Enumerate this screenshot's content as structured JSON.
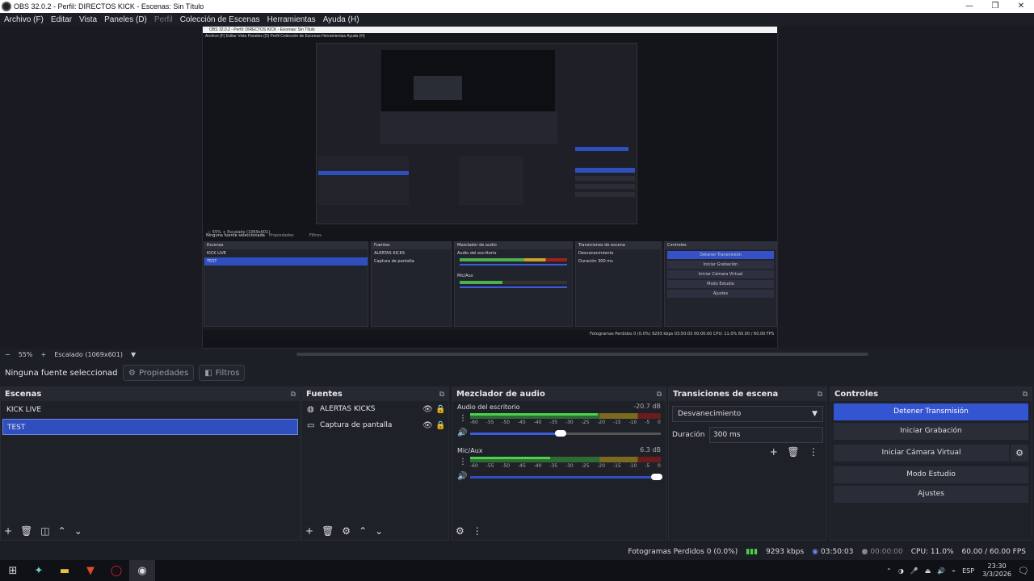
{
  "window": {
    "title": "OBS 32.0.2 - Perfil: DIRECTOS KICK - Escenas: Sin Título",
    "controls": [
      "—",
      "❐",
      "✕"
    ]
  },
  "menu": [
    {
      "label": "Archivo (F)",
      "enabled": true
    },
    {
      "label": "Editar",
      "enabled": true
    },
    {
      "label": "Vista",
      "enabled": true
    },
    {
      "label": "Paneles (D)",
      "enabled": true
    },
    {
      "label": "Perfil",
      "enabled": false
    },
    {
      "label": "Colección de Escenas",
      "enabled": true
    },
    {
      "label": "Herramientas",
      "enabled": true
    },
    {
      "label": "Ayuda (H)",
      "enabled": true
    }
  ],
  "zoom": {
    "minus": "−",
    "value": "55%",
    "plus": "+",
    "scaled": "Escalado (1069x601)"
  },
  "source_toolbar": {
    "no_source": "Ninguna fuente seleccionada",
    "properties": "Propiedades",
    "filters": "Filtros"
  },
  "scenes": {
    "title": "Escenas",
    "items": [
      {
        "label": "KICK LIVE",
        "selected": false
      },
      {
        "label": "TEST",
        "selected": true
      }
    ]
  },
  "sources": {
    "title": "Fuentes",
    "items": [
      {
        "label": "ALERTAS KICKS",
        "icon": "browser-icon"
      },
      {
        "label": "Captura de pantalla",
        "icon": "monitor-icon"
      }
    ]
  },
  "mixer": {
    "title": "Mezclador de audio",
    "channels": [
      {
        "name": "Audio del escritorio",
        "db": "-20.7 dB",
        "level": 0.67,
        "volume": 0.5
      },
      {
        "name": "Mic/Aux",
        "db": "6.3 dB",
        "level": 0.42,
        "volume": 1.0
      }
    ],
    "ticks": [
      "-60",
      "-55",
      "-50",
      "-45",
      "-40",
      "-35",
      "-30",
      "-25",
      "-20",
      "-15",
      "-10",
      "-5",
      "0"
    ]
  },
  "transitions": {
    "title": "Transiciones de escena",
    "selected": "Desvanecimiento",
    "duration_label": "Duración",
    "duration": "300 ms"
  },
  "controls": {
    "title": "Controles",
    "stop_stream": "Detener Transmisión",
    "start_record": "Iniciar Grabación",
    "virtual_cam": "Iniciar Cámara Virtual",
    "studio": "Modo Estudio",
    "settings": "Ajustes"
  },
  "status": {
    "dropped": "Fotogramas Perdidos 0 (0.0%)",
    "bitrate": "9293 kbps",
    "stream_time": "03:50:03",
    "rec_time": "00:00:00",
    "cpu": "CPU: 11.0%",
    "fps": "60.00 / 60.00 FPS"
  },
  "taskbar": {
    "lang": "ESP",
    "time": "23:30",
    "date": "3/3/2026"
  },
  "nested": {
    "title": "OBS 32.0.2 - Perfil: DIRECTOS KICK - Escenas: Sin Título",
    "menu": "Archivo (F)   Editar   Vista   Paneles (D)   Perfil   Colección de Escenas   Herramientas   Ayuda (H)",
    "zoom": "−  55%  +  Escalado (1069x601)",
    "no_source": "Ninguna fuente seleccionada",
    "props": "Propiedades",
    "filters": "Filtros",
    "scenes": "Escenas",
    "scene1": "KICK LIVE",
    "scene2": "TEST",
    "sources": "Fuentes",
    "src1": "ALERTAS KICKS",
    "src2": "Captura de pantalla",
    "mixer": "Mezclador de audio",
    "ch1": "Audio del escritorio",
    "ch1db": "-20.7 dB",
    "ch2": "Mic/Aux",
    "ch2db": "6.3 dB",
    "trans": "Transiciones de escena",
    "tsel": "Desvanecimiento",
    "tdur": "Duración",
    "tdurv": "300 ms",
    "ctrls": "Controles",
    "b1": "Detener Transmisión",
    "b2": "Iniciar Grabación",
    "b3": "Iniciar Cámara Virtual",
    "b4": "Modo Estudio",
    "b5": "Ajustes",
    "status": "Fotogramas Perdidos 0 (0.0%)   9293 kbps   03:50:03   00:00:00   CPU: 11.0%   60.00 / 60.00 FPS"
  }
}
